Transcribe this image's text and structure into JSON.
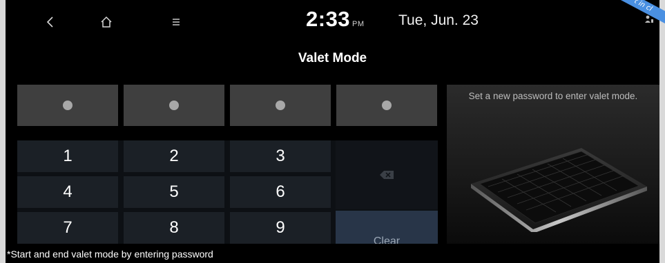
{
  "status_bar": {
    "back_icon": "chevron-left-icon",
    "home_icon": "home-icon",
    "menu_icon": "menu-icon",
    "time": "2:33",
    "ampm": "PM",
    "date": "Tue, Jun. 23",
    "ribbon_text": "t in cl"
  },
  "screen": {
    "title": "Valet Mode"
  },
  "password": {
    "digits_entered": 4,
    "dot_color": "#a8a8a8"
  },
  "keypad": {
    "keys": [
      "1",
      "2",
      "3",
      "4",
      "5",
      "6",
      "7",
      "8",
      "9"
    ],
    "backspace_icon": "backspace-icon",
    "clear_label": "Clear"
  },
  "info": {
    "message": "Set a new password to enter valet mode.",
    "illustration": "keyboard-illustration"
  },
  "footer": {
    "note": "*Start and end valet mode by entering password"
  },
  "colors": {
    "background": "#000000",
    "password_cell": "#3f3f3f",
    "key": "#1b2026",
    "clear_key": "#283548"
  }
}
